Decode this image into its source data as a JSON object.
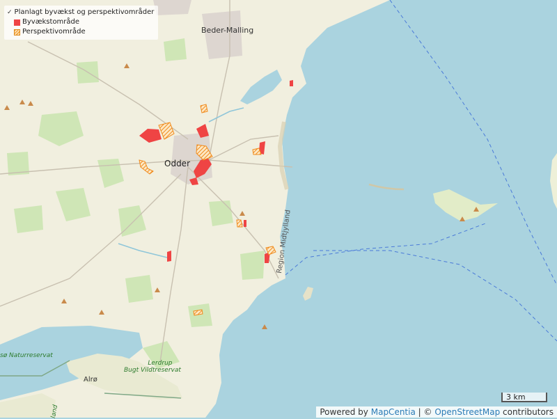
{
  "legend": {
    "layer_title": "Planlagt byvækst og perspektivområder",
    "items": [
      {
        "label": "Byvækstområde",
        "color": "#ef4444"
      },
      {
        "label": "Perspektivområde",
        "color": "#f4a640"
      }
    ]
  },
  "places": {
    "beder_malling": "Beder-Malling",
    "odder": "Odder",
    "alro": "Alrø",
    "region": "Region Midtjylland",
    "naturreservat": "sø Naturreservat",
    "lerdrup_1": "Lerdrup",
    "lerdrup_2": "Bugt Vildtreservat",
    "edge_label": "land"
  },
  "scale": {
    "label": "3 km"
  },
  "attribution": {
    "prefix": "Powered by",
    "provider": "MapCentia",
    "separator": "| ©",
    "osm": "OpenStreetMap",
    "suffix": "contributors"
  },
  "colors": {
    "sea": "#aad3df",
    "land": "#f2efe0",
    "forest": "#cfe6b8",
    "growth": "#ef4444",
    "perspective": "#f4a640"
  }
}
